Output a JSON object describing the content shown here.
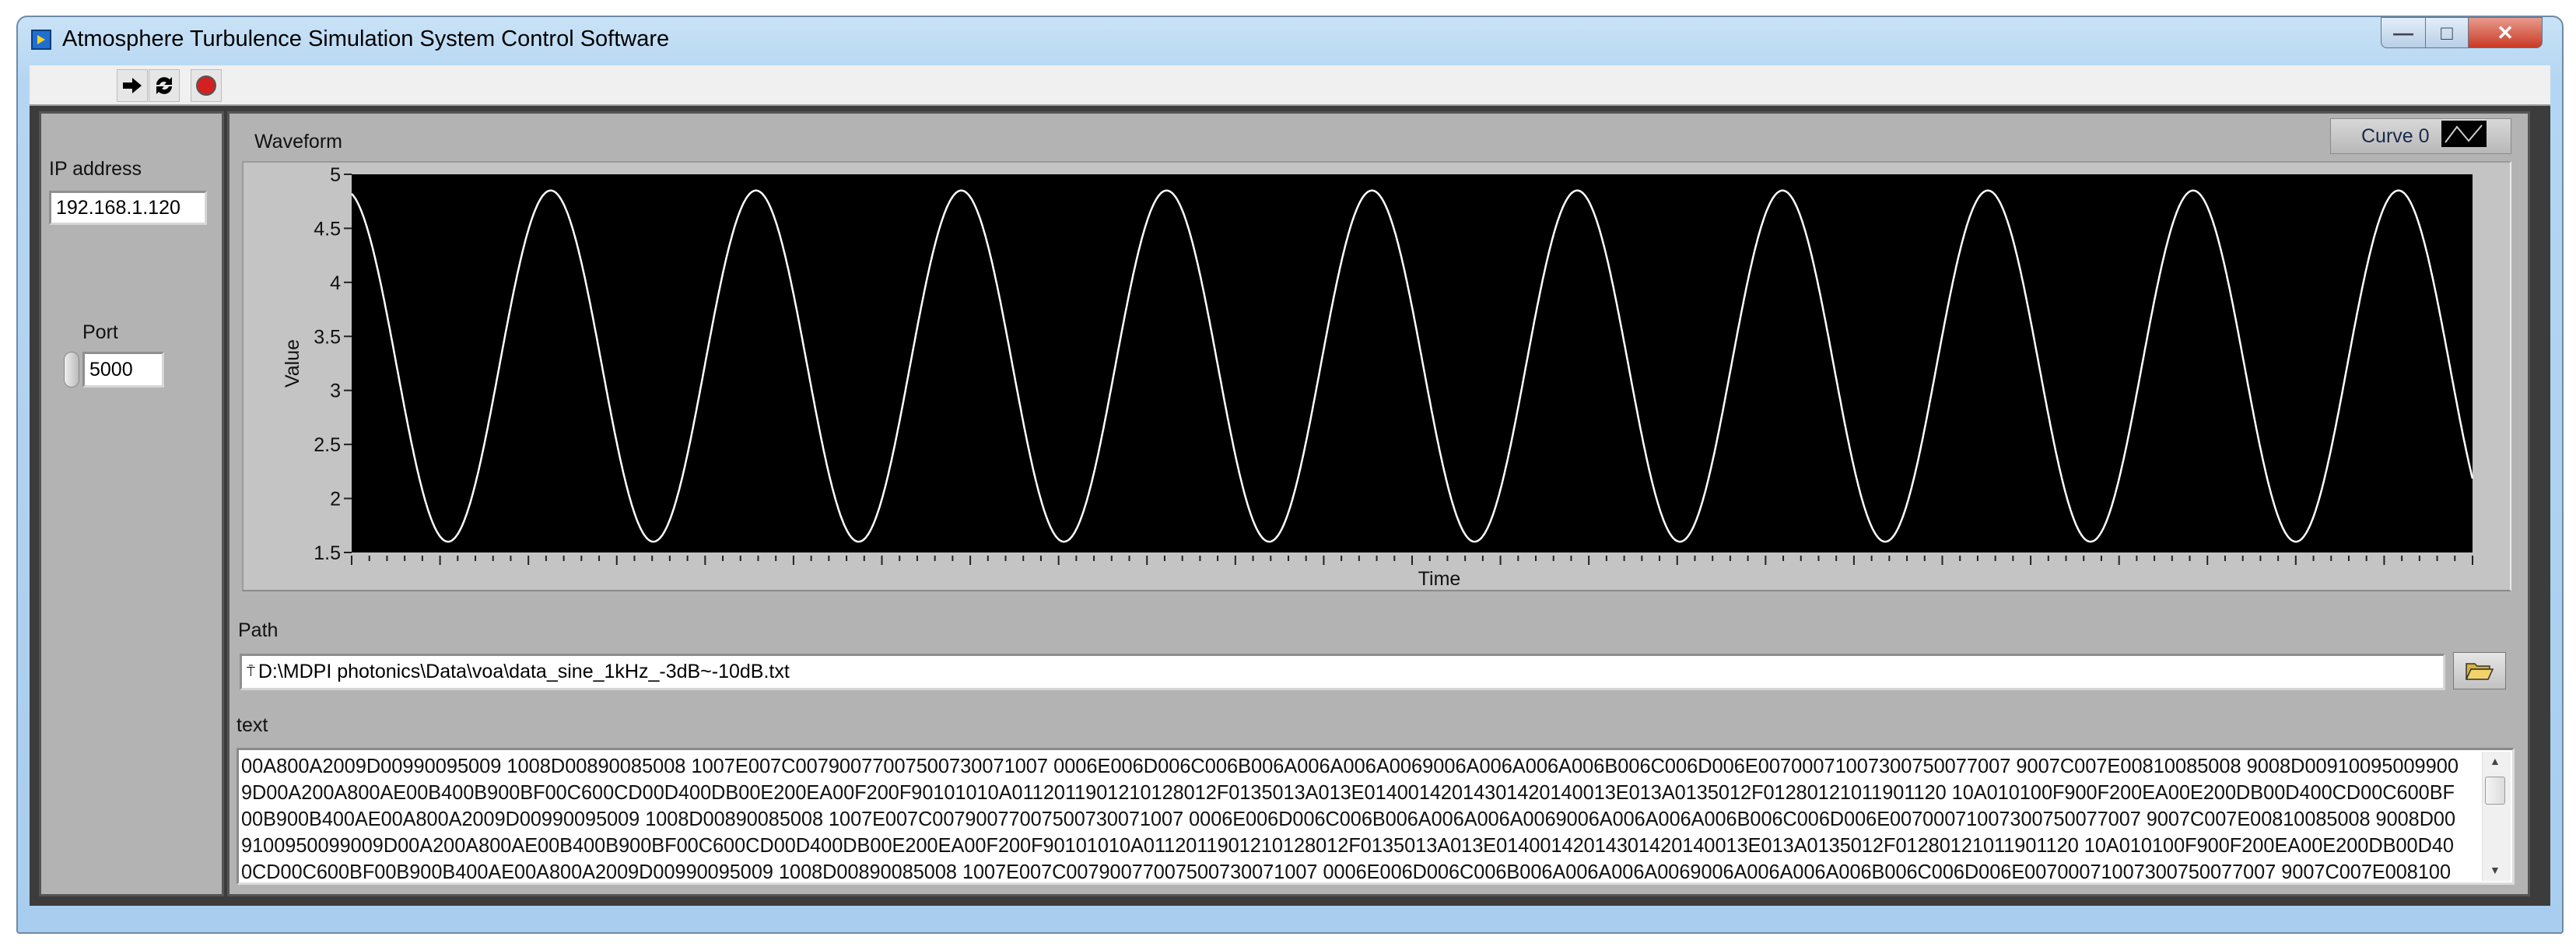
{
  "window": {
    "title": "Atmosphere Turbulence Simulation System Control Software",
    "minimize_label": "—",
    "maximize_label": "□",
    "close_label": "✕"
  },
  "toolbar": {
    "run_icon": "run-arrow-icon",
    "run_continuous_icon": "run-continuously-icon",
    "abort_icon": "abort-stop-icon"
  },
  "connection": {
    "ip_label": "IP address",
    "ip_value": "192.168.1.120",
    "port_label": "Port",
    "port_value": "5000"
  },
  "graph": {
    "label": "Waveform",
    "legend_label": "Curve 0"
  },
  "chart_data": {
    "type": "line",
    "title": "Waveform",
    "xlabel": "Time",
    "ylabel": "Value",
    "ylim": [
      1.5,
      5
    ],
    "yticks": [
      "5",
      "4.5",
      "4",
      "3.5",
      "3",
      "2.5",
      "2",
      "1.5"
    ],
    "xticks_labeled": false,
    "grid": false,
    "legend": "top-right",
    "series": [
      {
        "name": "Curve 0",
        "shape": "sine",
        "min": 1.6,
        "max": 4.85,
        "cycles_visible": 10.33,
        "start_value": 4.82,
        "end_value": 2.6,
        "color": "#ffffff"
      }
    ],
    "background": "#000000"
  },
  "path": {
    "label": "Path",
    "value": "D:\\MDPI photonics\\Data\\voa\\data_sine_1kHz_-3dB~-10dB.txt"
  },
  "text": {
    "label": "text",
    "lines": [
      "00A800A2009D00990095009 1008D00890085008 1007E007C00790077007500730071007 0006E006D006C006B006A006A006A0069006A006A006A006B006C006D006E00700071007300750077007 9007C007E00810085008 9008D00910095009900",
      "9D00A200A800AE00B400B900BF00C600CD00D400DB00E200EA00F200F90101010A0112011901210128012F0135013A013E01400142014301420140013E013A0135012F01280121011901120 10A010100F900F200EA00E200DB00D400CD00C600BF",
      "00B900B400AE00A800A2009D00990095009 1008D00890085008 1007E007C00790077007500730071007 0006E006D006C006B006A006A006A0069006A006A006A006B006C006D006E00700071007300750077007 9007C007E00810085008 9008D00",
      "9100950099009D00A200A800AE00B400B900BF00C600CD00D400DB00E200EA00F200F90101010A0112011901210128012F0135013A013E01400142014301420140013E013A0135012F01280121011901120 10A010100F900F200EA00E200DB00D40",
      "0CD00C600BF00B900B400AE00A800A2009D00990095009 1008D00890085008 1007E007C00790077007500730071007 0006E006D006C006B006A006A006A0069006A006A006A006B006C006D006E00700071007300750077007 9007C007E008100"
    ]
  },
  "colors": {
    "panel": "#b3b3b3",
    "plot_background": "#000000",
    "trace": "#ffffff",
    "titlebar": "#b5d6f2",
    "close_button": "#c93a24",
    "abort_button": "#d42020"
  }
}
